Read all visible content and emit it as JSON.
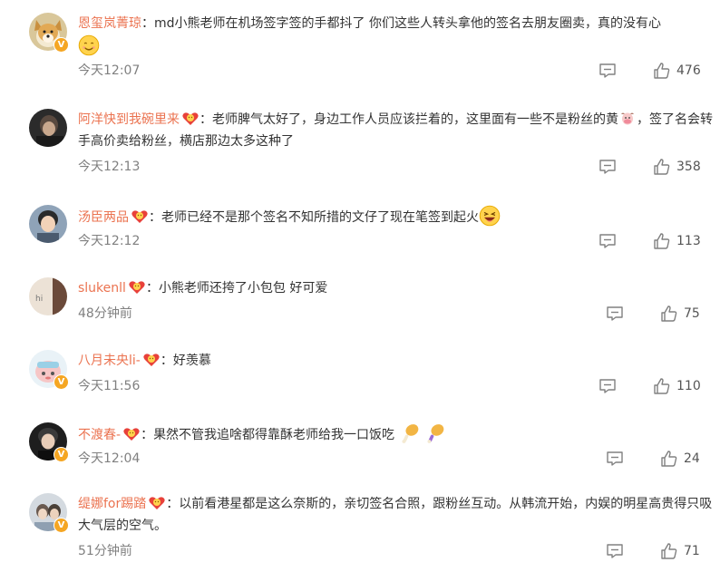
{
  "comments": [
    {
      "username": "恩玺岚菁琼",
      "colon": "：",
      "text": "md小熊老师在机场签字签的手都抖了 你们这些人转头拿他的签名去朋友圈卖，真的没有心",
      "time": "今天12:07",
      "likes": "476",
      "avatar_color": "#e8d3a0",
      "verified": true
    },
    {
      "username": "阿洋快到我碗里来",
      "colon": "：",
      "text": "老师脾气太好了，身边工作人员应该拦着的，这里面有一些不是粉丝的黄",
      "text_cont": "，签了名会转手高价卖给粉丝，横店那边太多这种了",
      "time": "今天12:13",
      "likes": "358",
      "avatar_color": "#3a3a3a",
      "verified": false
    },
    {
      "username": "汤臣两品",
      "colon": "：",
      "text": "老师已经不是那个签名不知所措的文仔了现在笔签到起火",
      "time": "今天12:12",
      "likes": "113",
      "avatar_color": "#7b8aa0",
      "verified": false
    },
    {
      "username": "slukenll",
      "colon": "：",
      "text": "小熊老师还挎了小包包 好可爱",
      "time": "48分钟前",
      "likes": "75",
      "avatar_color": "#e6d9cc",
      "avatar_text": "hi",
      "verified": false
    },
    {
      "username": "八月未央li-",
      "colon": "：",
      "text": "好羡慕",
      "time": "今天11:56",
      "likes": "110",
      "avatar_color": "#f2c7c7",
      "verified": true
    },
    {
      "username": "不渡春-",
      "colon": "：",
      "text": "果然不管我追啥都得靠酥老师给我一口饭吃",
      "time": "今天12:04",
      "likes": "24",
      "avatar_color": "#2e2e2e",
      "verified": true
    },
    {
      "username": "缇娜for踢踏",
      "colon": "：",
      "text": "以前看港星都是这么奈斯的，亲切签名合照，跟粉丝互动。从韩流开始，内娱的明星高贵得只吸大气层的空气。",
      "time": "51分钟前",
      "likes": "71",
      "avatar_color": "#c9cfd6",
      "verified": true
    }
  ],
  "colors": {
    "username": "#eb7350",
    "meta": "#808080",
    "text": "#333333"
  },
  "icons": {
    "reply": "comment-reply-icon",
    "like": "thumbs-up-icon",
    "fan_badge": "fan-heart-badge-icon",
    "verified": "verified-v-badge-icon"
  }
}
